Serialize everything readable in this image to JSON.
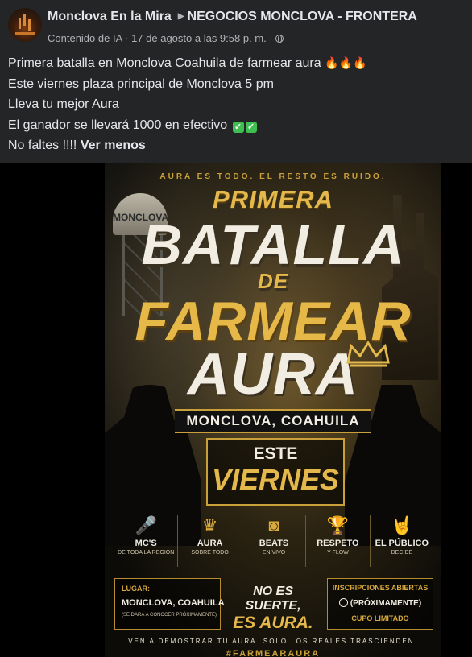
{
  "post": {
    "page_name": "Monclova En la Mira",
    "group_name": "NEGOCIOS MONCLOVA - FRONTERA",
    "meta": "Contenido de IA · 17 de agosto a las 9:58 p. m. ·",
    "lines": [
      "Primera batalla en Monclova Coahuila de farmear aura",
      "Este viernes plaza principal de Monclova 5 pm",
      "Lleva tu mejor Aura",
      "El ganador se llevará 1000 en efectivo",
      "No faltes !!!!"
    ],
    "see_less": "Ver menos"
  },
  "poster": {
    "tagline_top": "AURA ES TODO.  EL RESTO ES RUIDO.",
    "tower_label": "MONCLOVA",
    "title_primera": "PRIMERA",
    "title_batalla": "BATALLA",
    "title_de": "DE",
    "title_farmear": "FARMEAR",
    "title_aura": "AURA",
    "location": "MONCLOVA, COAHUILA",
    "este": "ESTE",
    "viernes": "VIERNES",
    "features": [
      {
        "icon": "microphone-icon",
        "glyph": "🎤",
        "title": "MC'S",
        "sub": "DE TODA LA REGIÓN"
      },
      {
        "icon": "crown-icon",
        "glyph": "♛",
        "title": "AURA",
        "sub": "SOBRE TODO"
      },
      {
        "icon": "speaker-icon",
        "glyph": "◙",
        "title": "BEATS",
        "sub": "EN VIVO"
      },
      {
        "icon": "trophy-icon",
        "glyph": "🏆",
        "title": "RESPETO",
        "sub": "Y FLOW"
      },
      {
        "icon": "rock-hand-icon",
        "glyph": "🤘",
        "title": "EL PÚBLICO",
        "sub": "DECIDE"
      }
    ],
    "lugar_label": "LUGAR:",
    "lugar_value": "MONCLOVA, COAHUILA",
    "lugar_note": "(SE DARÁ A CONOCER PRÓXIMAMENTE)",
    "suerte_1": "NO ES SUERTE,",
    "suerte_2": "ES AURA.",
    "inscr_label": "INSCRIPCIONES ABIERTAS",
    "inscr_wa": "(PRÓXIMAMENTE)",
    "cupo": "CUPO LIMITADO",
    "tagline_bottom": "VEN A DEMOSTRAR TU AURA.  SOLO LOS REALES TRASCIENDEN.",
    "hashtag": "#FARMEARAURA"
  },
  "colors": {
    "background": "#242526",
    "text": "#e4e6eb",
    "muted": "#b0b3b8",
    "gold": "#e4b84a"
  }
}
